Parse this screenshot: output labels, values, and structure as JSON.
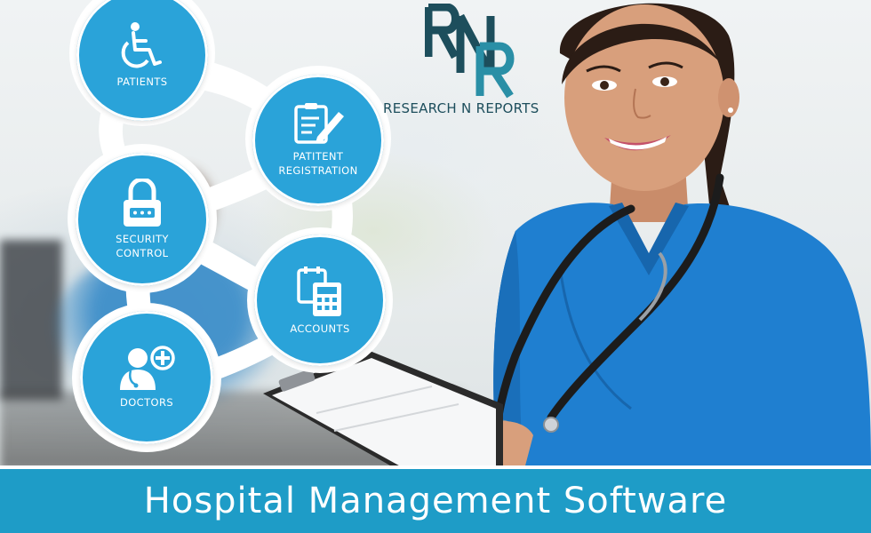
{
  "brand": {
    "logo_letters": "RNR",
    "name": "RESEARCH N REPORTS",
    "color_dark": "#1d4e5c",
    "color_teal": "#2a8fa6"
  },
  "features": [
    {
      "label": "PATIENTS",
      "icon": "wheelchair-icon"
    },
    {
      "label": "PATITENT\nREGISTRATION",
      "icon": "clipboard-edit-icon"
    },
    {
      "label": "SECURITY\nCONTROL",
      "icon": "padlock-icon"
    },
    {
      "label": "ACCOUNTS",
      "icon": "calculator-calendar-icon"
    },
    {
      "label": "DOCTORS",
      "icon": "doctor-plus-icon"
    }
  ],
  "banner": {
    "title": "Hospital Management Software"
  },
  "colors": {
    "accent": "#2aa3d9",
    "banner": "#1e9cc7",
    "scrubs": "#1f7fd0"
  }
}
